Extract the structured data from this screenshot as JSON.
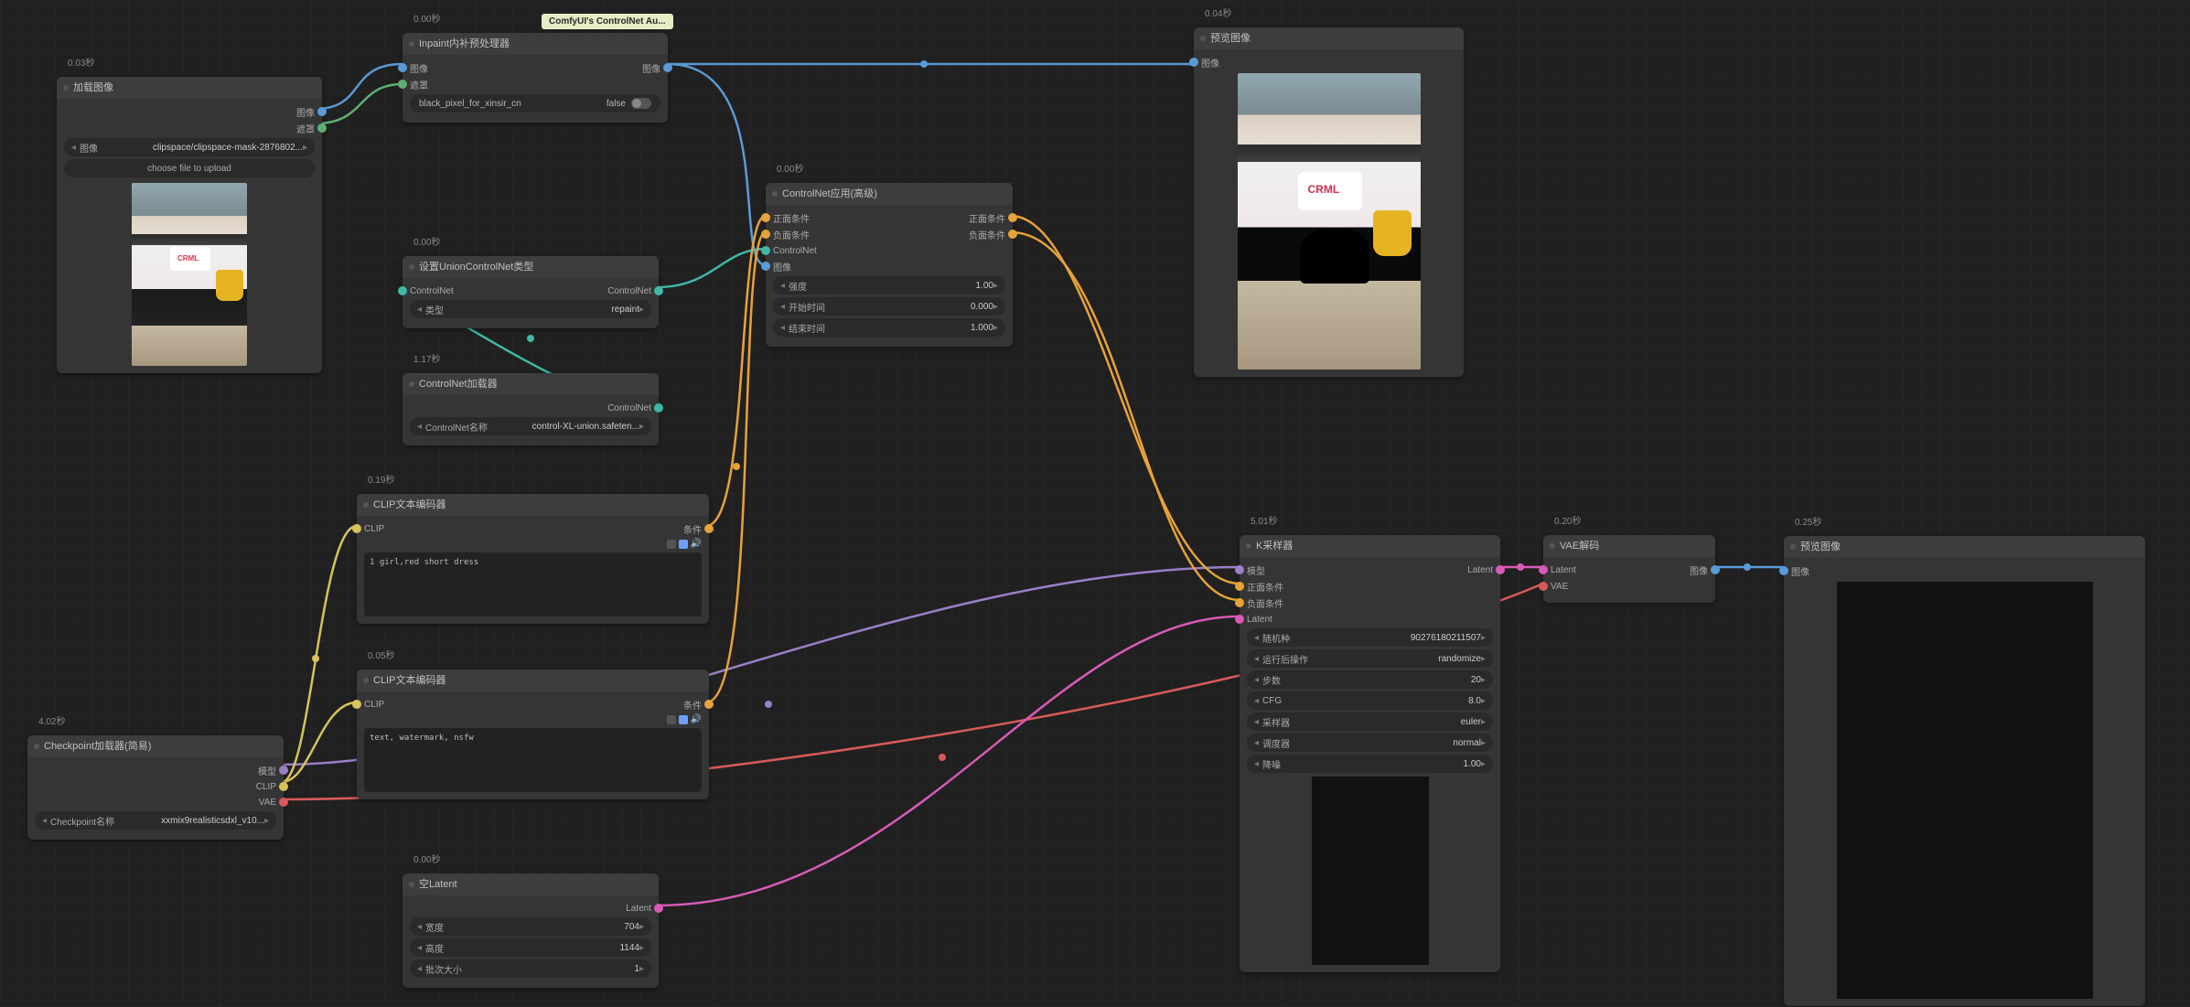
{
  "tooltip": "ComfyUI's ControlNet Au...",
  "nodes": {
    "loadimage": {
      "timing": "0.03秒",
      "title": "加载图像",
      "out_image": "图像",
      "out_mask": "遮罩",
      "file": "clipspace/clipspace-mask-2876802...",
      "upload": "choose file to upload"
    },
    "inpaint": {
      "timing": "0.00秒",
      "title": "Inpaint内补预处理器",
      "in_image": "图像",
      "in_mask": "遮罩",
      "out_image": "图像",
      "widget_name": "black_pixel_for_xinsir_cn",
      "widget_val": "false"
    },
    "setunion": {
      "timing": "0.00秒",
      "title": "设置UnionControlNet类型",
      "in_cn": "ControlNet",
      "out_cn": "ControlNet",
      "w1_lbl": "类型",
      "w1_val": "repaint"
    },
    "cnloader": {
      "timing": "1.17秒",
      "title": "ControlNet加载器",
      "out_cn": "ControlNet",
      "w1_lbl": "ControlNet名称",
      "w1_val": "control-XL-union.safeten..."
    },
    "clip1": {
      "timing": "0.19秒",
      "title": "CLIP文本编码器",
      "in_clip": "CLIP",
      "out_cond": "条件",
      "text": "1 girl,red short dress"
    },
    "clip2": {
      "timing": "0.05秒",
      "title": "CLIP文本编码器",
      "in_clip": "CLIP",
      "out_cond": "条件",
      "text": "text, watermark, nsfw"
    },
    "ckpt": {
      "timing": "4.02秒",
      "title": "Checkpoint加载器(简易)",
      "out_model": "模型",
      "out_clip": "CLIP",
      "out_vae": "VAE",
      "w1_lbl": "Checkpoint名称",
      "w1_val": "xxmix9realisticsdxl_v10..."
    },
    "cnapply": {
      "timing": "0.00秒",
      "title": "ControlNet应用(高级)",
      "in_pos": "正面条件",
      "in_neg": "负面条件",
      "in_cn": "ControlNet",
      "in_img": "图像",
      "out_pos": "正面条件",
      "out_neg": "负面条件",
      "w1_lbl": "强度",
      "w1_val": "1.00",
      "w2_lbl": "开始时间",
      "w2_val": "0.000",
      "w3_lbl": "结束时间",
      "w3_val": "1.000"
    },
    "empty": {
      "timing": "0.00秒",
      "title": "空Latent",
      "out_latent": "Latent",
      "w1_lbl": "宽度",
      "w1_val": "704",
      "w2_lbl": "高度",
      "w2_val": "1144",
      "w3_lbl": "批次大小",
      "w3_val": "1"
    },
    "ksampler": {
      "timing": "5.01秒",
      "title": "K采样器",
      "in_model": "模型",
      "in_pos": "正面条件",
      "in_neg": "负面条件",
      "in_latent": "Latent",
      "out_latent": "Latent",
      "w1_lbl": "随机种",
      "w1_val": "90276180211507",
      "w2_lbl": "运行后操作",
      "w2_val": "randomize",
      "w3_lbl": "步数",
      "w3_val": "20",
      "w4_lbl": "CFG",
      "w4_val": "8.0",
      "w5_lbl": "采样器",
      "w5_val": "euler",
      "w6_lbl": "调度器",
      "w6_val": "normal",
      "w7_lbl": "降噪",
      "w7_val": "1.00"
    },
    "vaedec": {
      "timing": "0.20秒",
      "title": "VAE解码",
      "in_latent": "Latent",
      "in_vae": "VAE",
      "out_image": "图像"
    },
    "preview1": {
      "timing": "0.04秒",
      "title": "预览图像",
      "in_image": "图像"
    },
    "preview2": {
      "timing": "0.25秒",
      "title": "预览图像",
      "in_image": "图像"
    }
  }
}
